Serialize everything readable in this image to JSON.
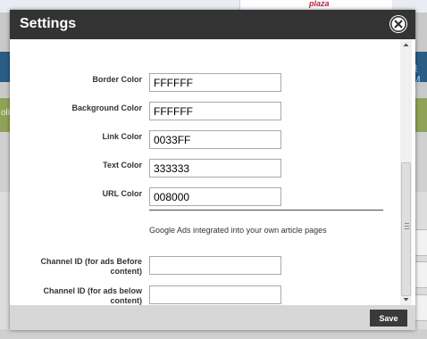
{
  "background": {
    "logo_text": "plaza",
    "nav_link_text": "n M",
    "bar_text": "oli"
  },
  "modal": {
    "title": "Settings",
    "fields": {
      "border_color": {
        "label": "Border Color",
        "value": "FFFFFF"
      },
      "background_color": {
        "label": "Background Color",
        "value": "FFFFFF"
      },
      "link_color": {
        "label": "Link Color",
        "value": "0033FF"
      },
      "text_color": {
        "label": "Text Color",
        "value": "333333"
      },
      "url_color": {
        "label": "URL Color",
        "value": "008000"
      }
    },
    "google_ads_note": "Google Ads integrated into your own article pages",
    "channel_before": {
      "label_line1": "Channel ID (for ads Before",
      "label_line2": "content)",
      "value": ""
    },
    "channel_below": {
      "label_line1": "Channel ID (for ads below",
      "label_line2": "content)",
      "value": ""
    },
    "save_label": "Save"
  },
  "colors": {
    "header_bg": "#333333",
    "footer_bg": "#d7d7d7",
    "save_bg": "#3a3a3a"
  },
  "icons": {
    "close": "close-circle-icon",
    "scroll_up": "arrow-up-icon",
    "scroll_down": "arrow-down-icon"
  }
}
